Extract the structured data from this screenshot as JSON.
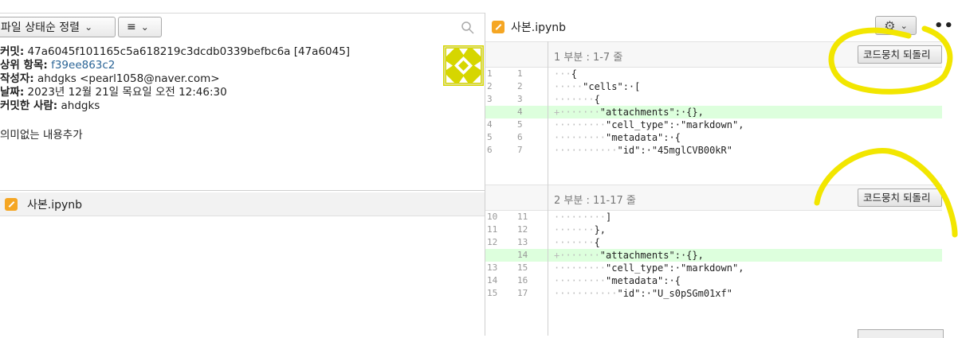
{
  "left": {
    "sort_label": "파일 상태순 정렬",
    "view_label": "≡",
    "commit": {
      "commit_label": "커밋:",
      "commit_value": "47a6045f101165c5a618219c3dcdb0339befbc6a [47a6045]",
      "parent_label": "상위 항목:",
      "parent_value": "f39ee863c2",
      "author_label": "작성자:",
      "author_value": "ahdgks <pearl1058@naver.com>",
      "date_label": "날짜:",
      "date_value": "2023년 12월 21일 목요일 오전 12:46:30",
      "committer_label": "커밋한 사람:",
      "committer_value": "ahdgks",
      "message": "의미없는 내용추가"
    },
    "file": {
      "name": "사본.ipynb"
    }
  },
  "right": {
    "file_name": "사본.ipynb",
    "more_label": "••",
    "hunks": [
      {
        "title": "1 부분 : 1-7 줄",
        "revert_label": "코드뭉치 되돌리",
        "lines": [
          {
            "old": "1",
            "new": "1",
            "code": "{",
            "indent": "···",
            "add": false
          },
          {
            "old": "2",
            "new": "2",
            "code": "\"cells\":·[",
            "indent": "·····",
            "add": false
          },
          {
            "old": "3",
            "new": "3",
            "code": "{",
            "indent": "·······",
            "add": false
          },
          {
            "old": "",
            "new": "4",
            "code": "\"attachments\":·{},",
            "indent": "+·······",
            "add": true
          },
          {
            "old": "4",
            "new": "5",
            "code": "\"cell_type\":·\"markdown\",",
            "indent": "·········",
            "add": false
          },
          {
            "old": "5",
            "new": "6",
            "code": "\"metadata\":·{",
            "indent": "·········",
            "add": false
          },
          {
            "old": "6",
            "new": "7",
            "code": "\"id\":·\"45mglCVB00kR\"",
            "indent": "···········",
            "add": false
          }
        ]
      },
      {
        "title": "2 부분 : 11-17 줄",
        "revert_label": "코드뭉치 되돌리",
        "lines": [
          {
            "old": "10",
            "new": "11",
            "code": "]",
            "indent": "·········",
            "add": false
          },
          {
            "old": "11",
            "new": "12",
            "code": "},",
            "indent": "·······",
            "add": false
          },
          {
            "old": "12",
            "new": "13",
            "code": "{",
            "indent": "·······",
            "add": false
          },
          {
            "old": "",
            "new": "14",
            "code": "\"attachments\":·{},",
            "indent": "+·······",
            "add": true
          },
          {
            "old": "13",
            "new": "15",
            "code": "\"cell_type\":·\"markdown\",",
            "indent": "·········",
            "add": false
          },
          {
            "old": "14",
            "new": "16",
            "code": "\"metadata\":·{",
            "indent": "·········",
            "add": false
          },
          {
            "old": "15",
            "new": "17",
            "code": "\"id\":·\"U_s0pSGm01xf\"",
            "indent": "···········",
            "add": false
          }
        ]
      }
    ]
  },
  "colors": {
    "added_line": "#ddffdd",
    "file_icon": "#f5a623",
    "annotation": "#f2e600",
    "link": "#2a6496"
  }
}
